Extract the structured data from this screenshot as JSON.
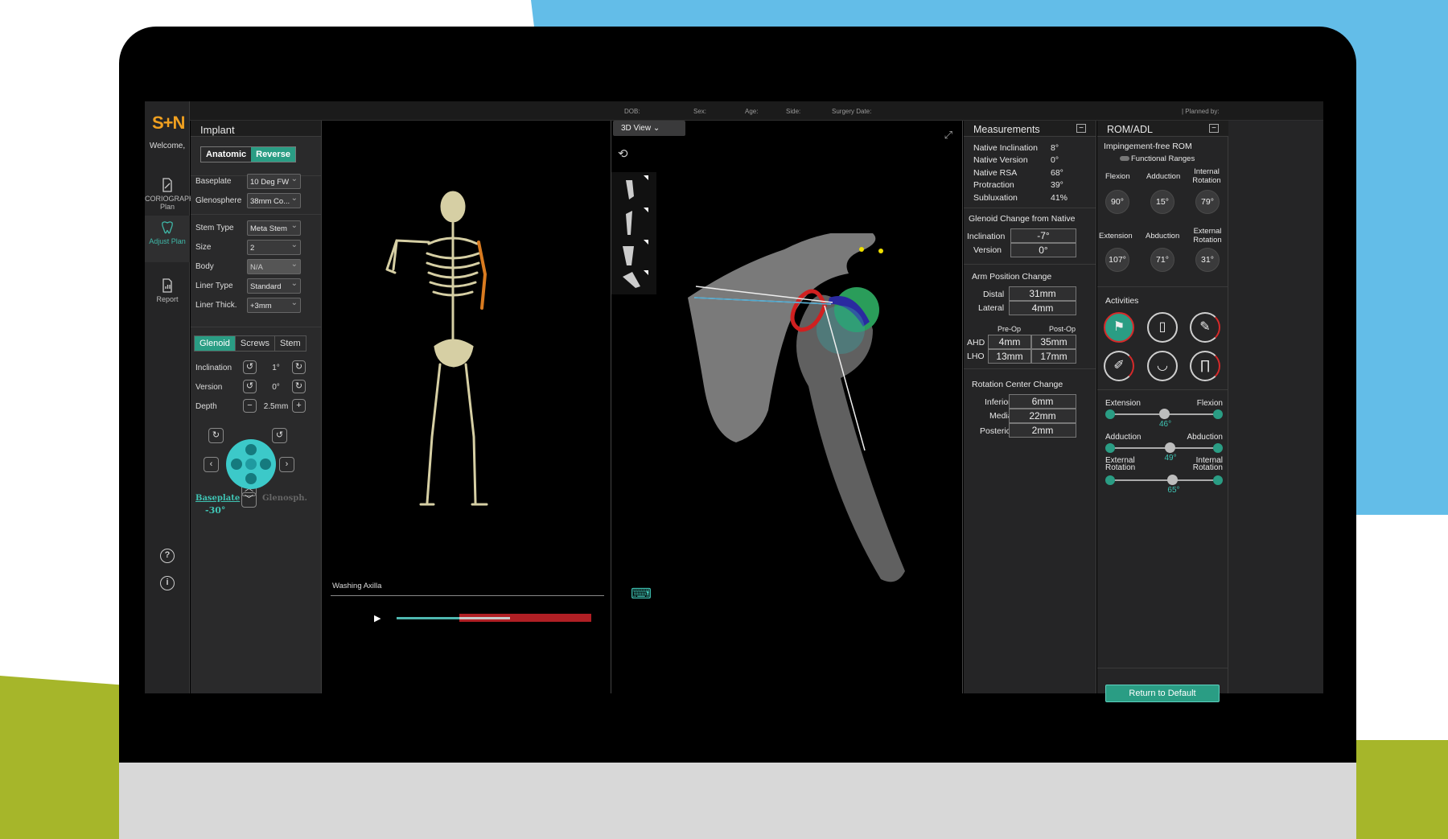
{
  "header": {
    "dob": "DOB:",
    "sex": "Sex:",
    "age": "Age:",
    "side": "Side:",
    "surgery_date": "Surgery Date:",
    "planned_by": "| Planned by:"
  },
  "rail": {
    "logo": "S+N",
    "welcome": "Welcome,",
    "items": [
      {
        "label": "CORIOGRAPH Plan",
        "icon": "plan-icon"
      },
      {
        "label": "Adjust Plan",
        "icon": "tooth-icon"
      },
      {
        "label": "Report",
        "icon": "report-icon"
      }
    ],
    "help": "?",
    "info": "i"
  },
  "implant": {
    "title": "Implant",
    "toggle": [
      "Anatomic",
      "Reverse"
    ],
    "fields": [
      {
        "label": "Baseplate",
        "value": "10 Deg FW"
      },
      {
        "label": "Glenosphere",
        "value": "38mm Co..."
      },
      {
        "label": "Stem Type",
        "value": "Meta Stem"
      },
      {
        "label": "Size",
        "value": "2"
      },
      {
        "label": "Body",
        "value": "N/A"
      },
      {
        "label": "Liner Type",
        "value": "Standard"
      },
      {
        "label": "Liner Thick.",
        "value": "+3mm"
      }
    ],
    "tabs": [
      "Glenoid",
      "Screws",
      "Stem"
    ],
    "adjust": [
      {
        "label": "Inclination",
        "value": "1°"
      },
      {
        "label": "Version",
        "value": "0°"
      },
      {
        "label": "Depth",
        "value": "2.5mm"
      }
    ],
    "rotate_target": "Baseplate",
    "rotate_value": "-30°",
    "rotate_alt": "Glenosph."
  },
  "animation": {
    "label": "Washing Axilla"
  },
  "view3d": {
    "tab": "3D View"
  },
  "measurements": {
    "title": "Measurements",
    "rows": [
      {
        "label": "Native Inclination",
        "value": "8°"
      },
      {
        "label": "Native Version",
        "value": "0°"
      },
      {
        "label": "Native RSA",
        "value": "68°"
      },
      {
        "label": "Protraction",
        "value": "39°"
      },
      {
        "label": "Subluxation",
        "value": "41%"
      }
    ],
    "glenoid_title": "Glenoid Change from Native",
    "glenoid": [
      {
        "label": "Inclination",
        "value": "-7°"
      },
      {
        "label": "Version",
        "value": "0°"
      }
    ],
    "arm_title": "Arm Position Change",
    "arm": [
      {
        "label": "Distal",
        "value": "31mm"
      },
      {
        "label": "Lateral",
        "value": "4mm"
      }
    ],
    "preop": "Pre-Op",
    "postop": "Post-Op",
    "ahd": {
      "label": "AHD",
      "pre": "4mm",
      "post": "35mm"
    },
    "lho": {
      "label": "LHO",
      "pre": "13mm",
      "post": "17mm"
    },
    "rc_title": "Rotation Center Change",
    "rc": [
      {
        "label": "Inferior",
        "value": "6mm"
      },
      {
        "label": "Medial",
        "value": "22mm"
      },
      {
        "label": "Posterior",
        "value": "2mm"
      }
    ]
  },
  "rom": {
    "title": "ROM/ADL",
    "subtitle": "Impingement-free ROM",
    "functional": "Functional Ranges",
    "row1_labels": [
      "Flexion",
      "Adduction",
      "Internal Rotation"
    ],
    "row1_values": [
      "90°",
      "15°",
      "79°"
    ],
    "row2_labels": [
      "Extension",
      "Abduction",
      "External Rotation"
    ],
    "row2_values": [
      "107°",
      "71°",
      "31°"
    ],
    "activities_title": "Activities",
    "sliders": [
      {
        "left": "Extension",
        "right": "Flexion",
        "value": "46°",
        "frac": 0.5
      },
      {
        "left": "Adduction",
        "right": "Abduction",
        "value": "49°",
        "frac": 0.55
      },
      {
        "left": "External Rotation",
        "right": "Internal Rotation",
        "value": "65°",
        "frac": 0.58
      }
    ],
    "return_label": "Return to Default"
  },
  "colors": {
    "accent": "#2a9d84",
    "logo": "#f0a020",
    "bar_red": "#b01f24"
  }
}
